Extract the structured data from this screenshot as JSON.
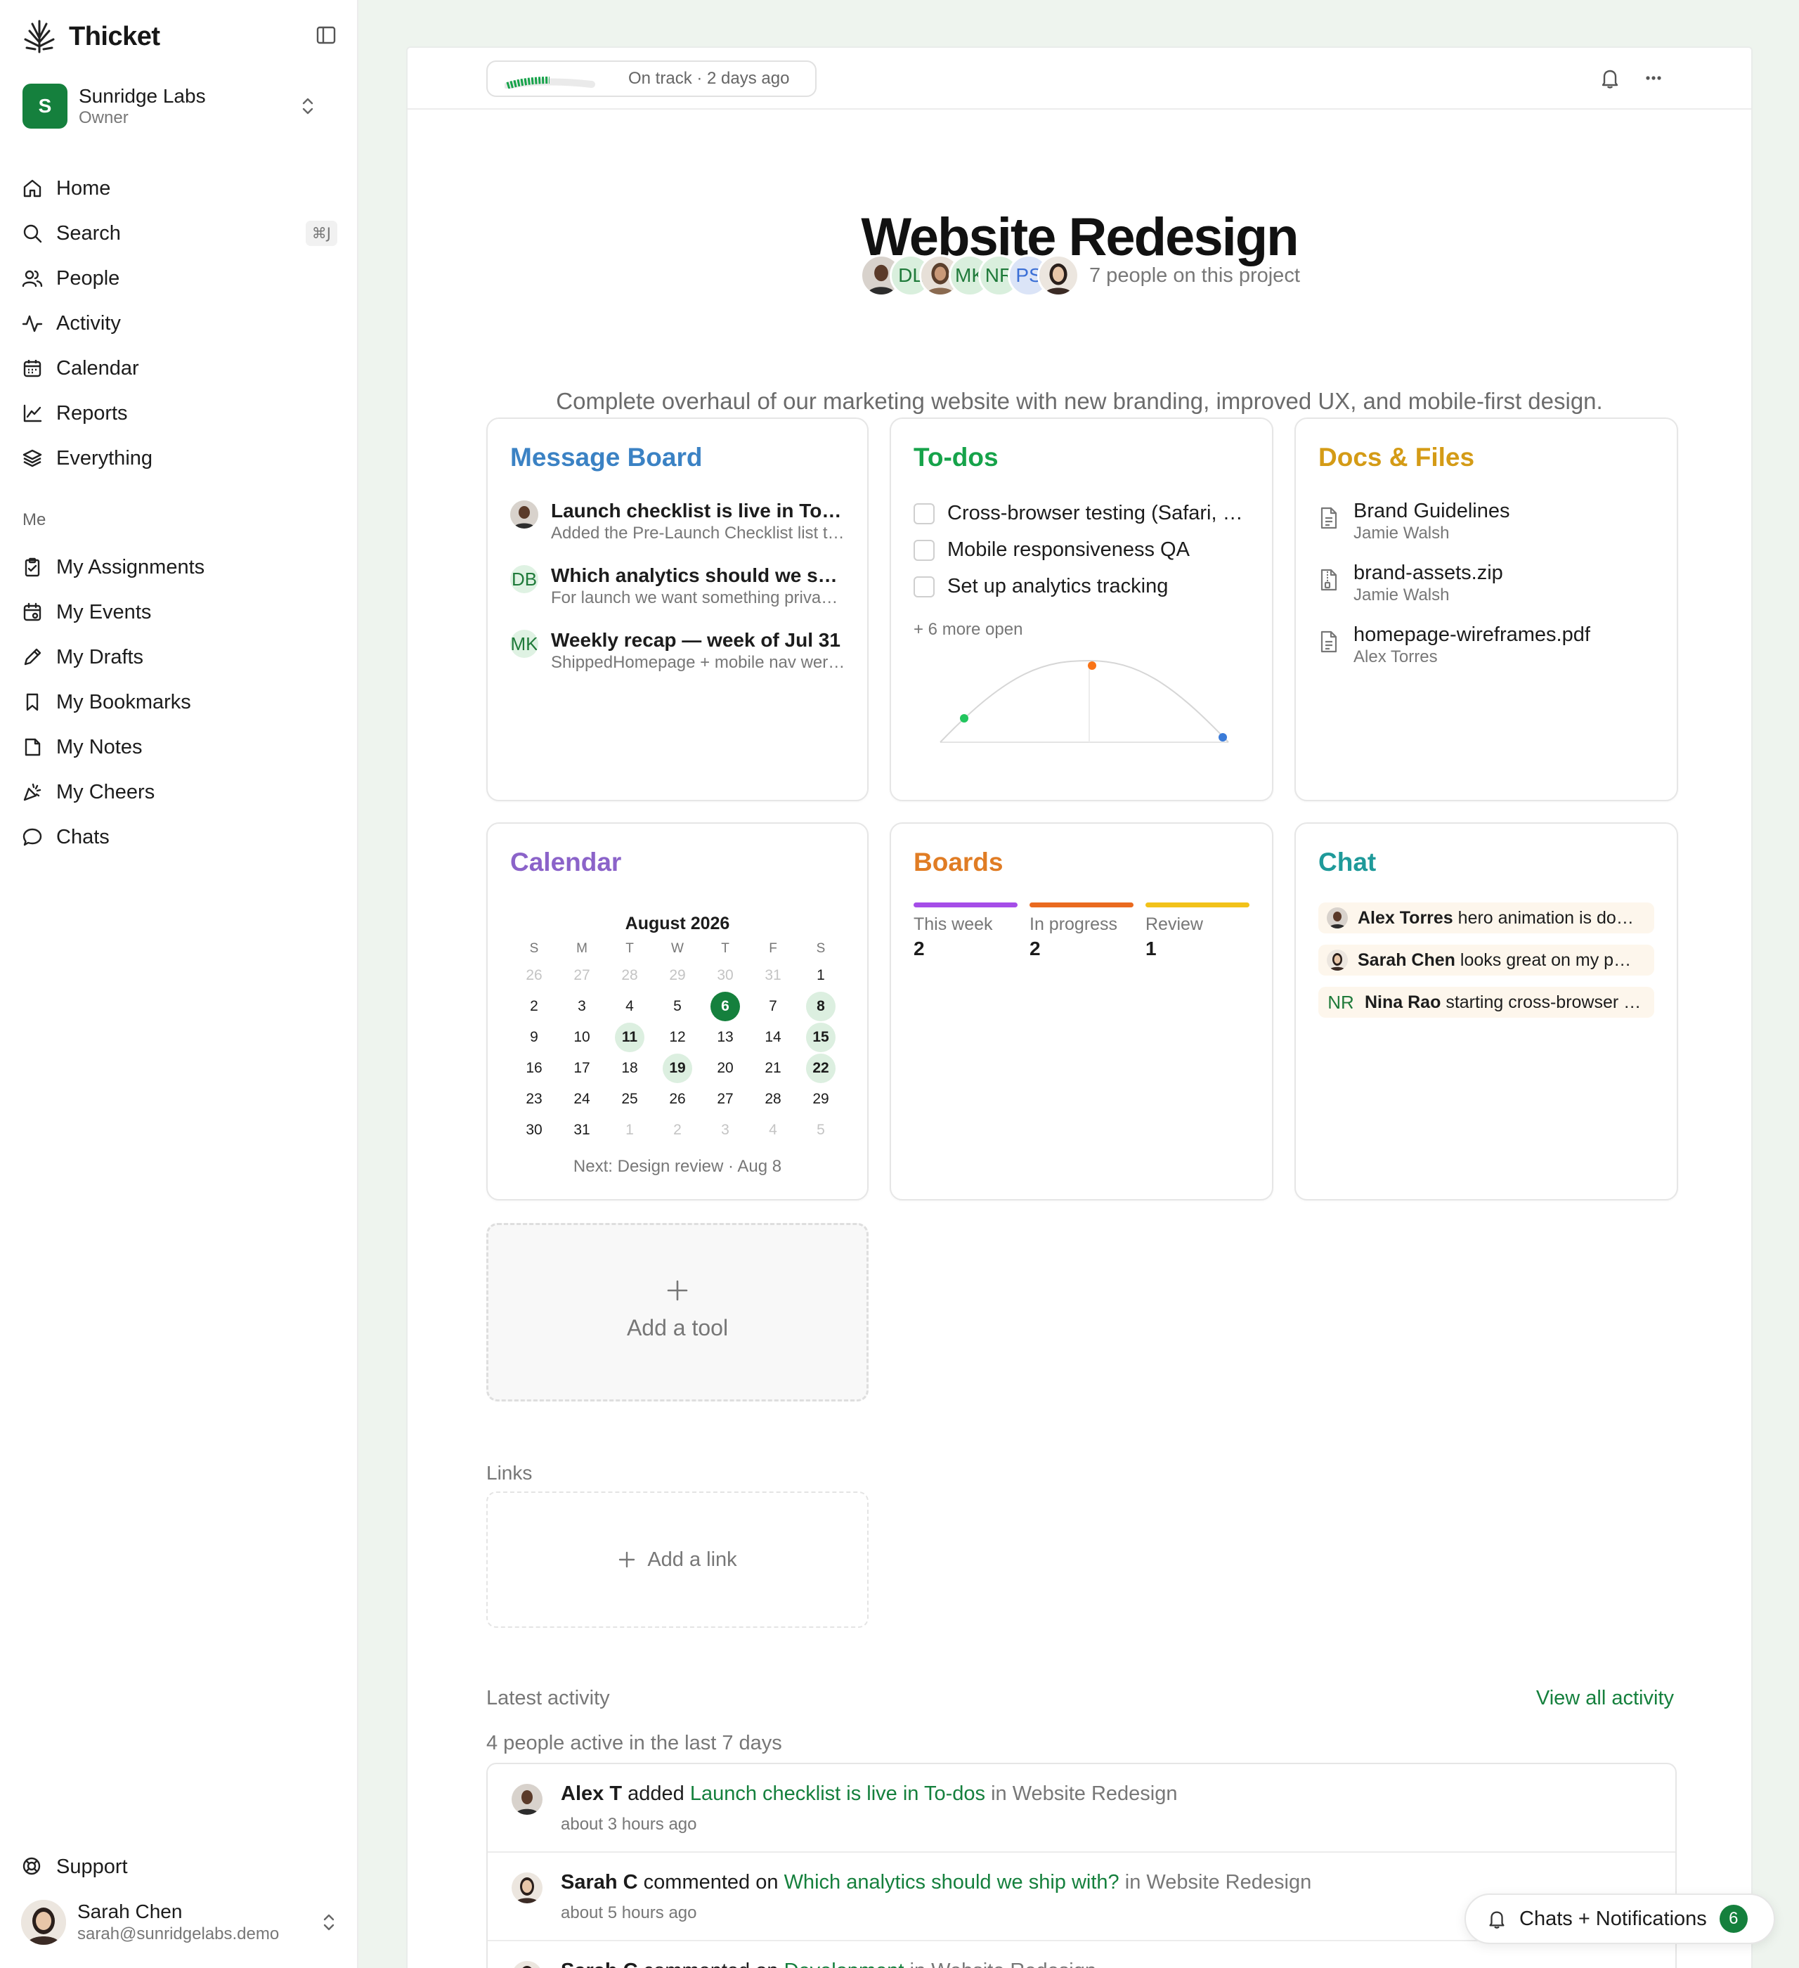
{
  "app": {
    "name": "Thicket",
    "org": {
      "name": "Sunridge Labs",
      "role": "Owner",
      "initial": "S"
    },
    "nav": [
      {
        "label": "Home",
        "icon": "home-icon"
      },
      {
        "label": "Search",
        "icon": "search-icon",
        "shortcut": "⌘J"
      },
      {
        "label": "People",
        "icon": "people-icon"
      },
      {
        "label": "Activity",
        "icon": "activity-icon"
      },
      {
        "label": "Calendar",
        "icon": "calendar-icon"
      },
      {
        "label": "Reports",
        "icon": "reports-icon"
      },
      {
        "label": "Everything",
        "icon": "layers-icon"
      }
    ],
    "me_label": "Me",
    "me_nav": [
      {
        "label": "My Assignments",
        "icon": "clipboard-icon"
      },
      {
        "label": "My Events",
        "icon": "calendar-event-icon"
      },
      {
        "label": "My Drafts",
        "icon": "pencil-icon"
      },
      {
        "label": "My Bookmarks",
        "icon": "bookmark-icon"
      },
      {
        "label": "My Notes",
        "icon": "note-icon"
      },
      {
        "label": "My Cheers",
        "icon": "party-icon"
      },
      {
        "label": "Chats",
        "icon": "chat-icon"
      }
    ],
    "support_label": "Support",
    "user": {
      "name": "Sarah Chen",
      "email": "sarah@sunridgelabs.demo"
    }
  },
  "project": {
    "status_text": "On track · 2 days ago",
    "title": "Website Redesign",
    "avatars": [
      "",
      "DL",
      "",
      "MK",
      "NR",
      "PS",
      ""
    ],
    "people_text": "7 people on this project",
    "description": "Complete overhaul of our marketing website with new branding, improved UX, and mobile-first design."
  },
  "colors": {
    "brand": "#15803d",
    "message_board": "#3b82c4",
    "todos": "#16a34a",
    "docs": "#d49b16",
    "calendar": "#8b63c9",
    "boards": "#e07c24",
    "chat": "#1f9a9a"
  },
  "message_board": {
    "title": "Message Board",
    "items": [
      {
        "avatar": "",
        "title": "Launch checklist is live in To-dos",
        "sub": "Added the Pre-Launch Checklist list to To-dos"
      },
      {
        "avatar": "DB",
        "title": "Which analytics should we ship with?",
        "sub": "For launch we want something privacy-friendly"
      },
      {
        "avatar": "MK",
        "title": "Weekly recap — week of Jul 31",
        "sub": "ShippedHomepage + mobile nav were merged"
      }
    ]
  },
  "todos": {
    "title": "To-dos",
    "items": [
      "Cross-browser testing (Safari, Firefox, Edge)",
      "Mobile responsiveness QA",
      "Set up analytics tracking"
    ],
    "more": "+ 6 more open"
  },
  "docs": {
    "title": "Docs & Files",
    "items": [
      {
        "name": "Brand Guidelines",
        "author": "Jamie Walsh",
        "icon": "document-icon"
      },
      {
        "name": "brand-assets.zip",
        "author": "Jamie Walsh",
        "icon": "zip-file-icon"
      },
      {
        "name": "homepage-wireframes.pdf",
        "author": "Alex Torres",
        "icon": "document-icon"
      }
    ]
  },
  "calendar": {
    "title": "Calendar",
    "month": "August 2026",
    "weekdays": [
      "S",
      "M",
      "T",
      "W",
      "T",
      "F",
      "S"
    ],
    "weeks": [
      [
        "26",
        "27",
        "28",
        "29",
        "30",
        "31",
        "1"
      ],
      [
        "2",
        "3",
        "4",
        "5",
        "6",
        "7",
        "8"
      ],
      [
        "9",
        "10",
        "11",
        "12",
        "13",
        "14",
        "15"
      ],
      [
        "16",
        "17",
        "18",
        "19",
        "20",
        "21",
        "22"
      ],
      [
        "23",
        "24",
        "25",
        "26",
        "27",
        "28",
        "29"
      ],
      [
        "30",
        "31",
        "1",
        "2",
        "3",
        "4",
        "5"
      ]
    ],
    "today": "6",
    "marked": [
      "8",
      "11",
      "15",
      "19",
      "22"
    ],
    "next": "Next: Design review · Aug 8"
  },
  "boards": {
    "title": "Boards",
    "columns": [
      {
        "label": "This week",
        "count": "2",
        "color": "#a54de8"
      },
      {
        "label": "In progress",
        "count": "2",
        "color": "#ea6a1f"
      },
      {
        "label": "Review",
        "count": "1",
        "color": "#f2c21a"
      }
    ]
  },
  "chat": {
    "title": "Chat",
    "lines": [
      {
        "avatar": "",
        "author": "Alex Torres",
        "text": "hero animation is done and merged"
      },
      {
        "avatar": "",
        "author": "Sarah Chen",
        "text": "looks great on my phone"
      },
      {
        "avatar": "NR",
        "author": "Nina Rao",
        "text": "starting cross-browser testing now"
      }
    ]
  },
  "add_tool_label": "Add a tool",
  "links": {
    "label": "Links",
    "add_label": "Add a link"
  },
  "activity": {
    "label": "Latest activity",
    "view_all": "View all activity",
    "summary": "4 people active in the last 7 days",
    "items": [
      {
        "who": "Alex T",
        "verb": "added",
        "link": "Launch checklist is live in To-dos",
        "where": "in Website Redesign",
        "time": "about 3 hours ago"
      },
      {
        "who": "Sarah C",
        "verb": "commented on",
        "link": "Which analytics should we ship with?",
        "where": "in Website Redesign",
        "time": "about 5 hours ago"
      },
      {
        "who": "Sarah C",
        "verb": "commented on",
        "link": "Development",
        "where": "in Website Redesign",
        "time": ""
      }
    ]
  },
  "notifications": {
    "label": "Chats + Notifications",
    "count": "6"
  }
}
